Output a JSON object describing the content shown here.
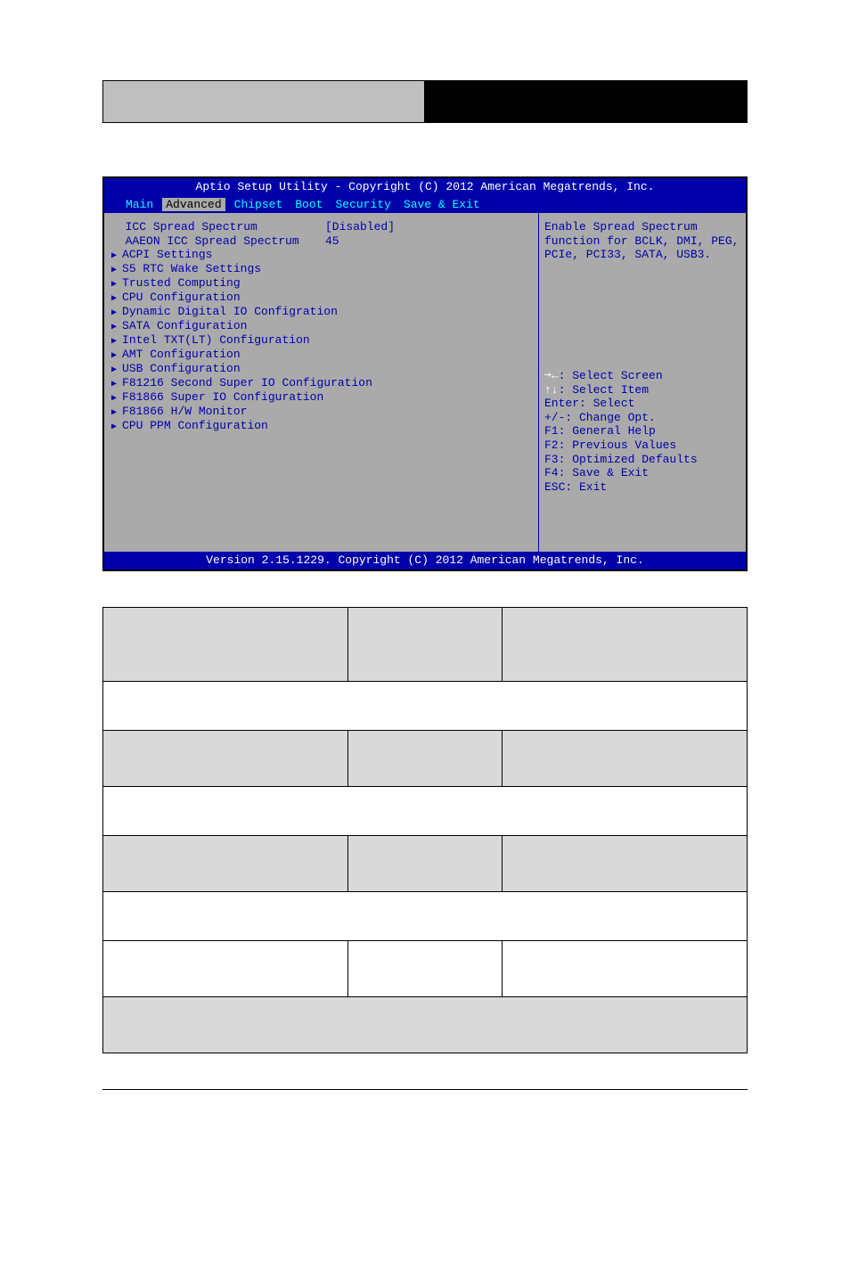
{
  "bios": {
    "title": "Aptio Setup Utility - Copyright (C) 2012 American Megatrends, Inc.",
    "footer": "Version 2.15.1229. Copyright (C) 2012 American Megatrends, Inc.",
    "tabs": [
      "Main",
      "Advanced",
      "Chipset",
      "Boot",
      "Security",
      "Save & Exit"
    ],
    "active_tab": "Advanced",
    "settings": [
      {
        "label": "ICC Spread Spectrum",
        "value": "[Disabled]"
      },
      {
        "label": "AAEON ICC Spread Spectrum",
        "value": "45"
      }
    ],
    "menu_items": [
      "ACPI Settings",
      "S5 RTC Wake Settings",
      "Trusted Computing",
      "CPU Configuration",
      "Dynamic Digital IO Configration",
      "SATA Configuration",
      "Intel TXT(LT) Configuration",
      "AMT Configuration",
      "USB Configuration",
      "F81216 Second Super IO Configuration",
      "F81866 Super IO Configuration",
      "F81866 H/W Monitor",
      "CPU PPM Configuration"
    ],
    "help_text": "Enable Spread Spectrum function for BCLK, DMI, PEG, PCIe, PCI33, SATA, USB3.",
    "key_help": [
      {
        "sym": "➞←",
        "text": ": Select Screen"
      },
      {
        "sym": "↑↓",
        "text": ": Select Item"
      },
      {
        "sym": "Enter",
        "text": ": Select"
      },
      {
        "sym": "+/-",
        "text": ": Change Opt."
      },
      {
        "sym": "F1",
        "text": ": General Help"
      },
      {
        "sym": "F2",
        "text": ": Previous Values"
      },
      {
        "sym": "F3",
        "text": ": Optimized Defaults"
      },
      {
        "sym": "F4",
        "text": ": Save & Exit"
      },
      {
        "sym": "ESC",
        "text": ": Exit"
      }
    ]
  },
  "table": {
    "rows": [
      {
        "type": "header",
        "cells": [
          "",
          "",
          ""
        ]
      },
      {
        "type": "full",
        "text": ""
      },
      {
        "type": "shaded3",
        "cells": [
          "",
          "",
          ""
        ]
      },
      {
        "type": "full",
        "text": ""
      },
      {
        "type": "shaded3",
        "cells": [
          "",
          "",
          ""
        ]
      },
      {
        "type": "full",
        "text": ""
      },
      {
        "type": "plain3",
        "cells": [
          "",
          "",
          ""
        ]
      },
      {
        "type": "fullshaded",
        "text": ""
      }
    ]
  }
}
